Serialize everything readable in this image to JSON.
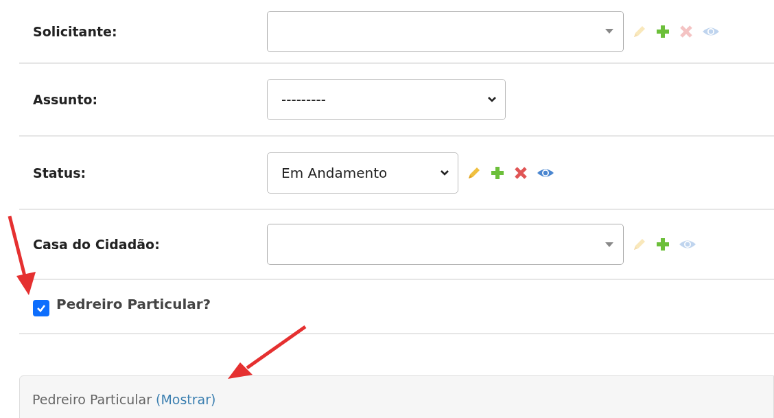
{
  "fields": [
    {
      "label": "Solicitante:",
      "kind": "select2",
      "actions": [
        {
          "kind": "edit",
          "disabled": true
        },
        {
          "kind": "add",
          "disabled": false
        },
        {
          "kind": "delete",
          "disabled": true
        },
        {
          "kind": "view",
          "disabled": true
        }
      ]
    },
    {
      "label": "Assunto:",
      "kind": "select",
      "value": "---------"
    },
    {
      "label": "Status:",
      "kind": "select",
      "value": "Em Andamento",
      "actions": [
        {
          "kind": "edit",
          "disabled": false
        },
        {
          "kind": "add",
          "disabled": false
        },
        {
          "kind": "delete",
          "disabled": false
        },
        {
          "kind": "view",
          "disabled": false
        }
      ]
    },
    {
      "label": "Casa do Cidadão:",
      "kind": "select2",
      "actions": [
        {
          "kind": "edit",
          "disabled": true
        },
        {
          "kind": "add",
          "disabled": false
        },
        {
          "kind": "view",
          "disabled": true
        }
      ]
    }
  ],
  "checkbox": {
    "label": "Pedreiro Particular?",
    "checked": true
  },
  "fieldset": {
    "title": "Pedreiro Particular",
    "link": "(Mostrar)"
  },
  "annotations": [
    {
      "kind": "arrow"
    },
    {
      "kind": "arrow"
    }
  ]
}
